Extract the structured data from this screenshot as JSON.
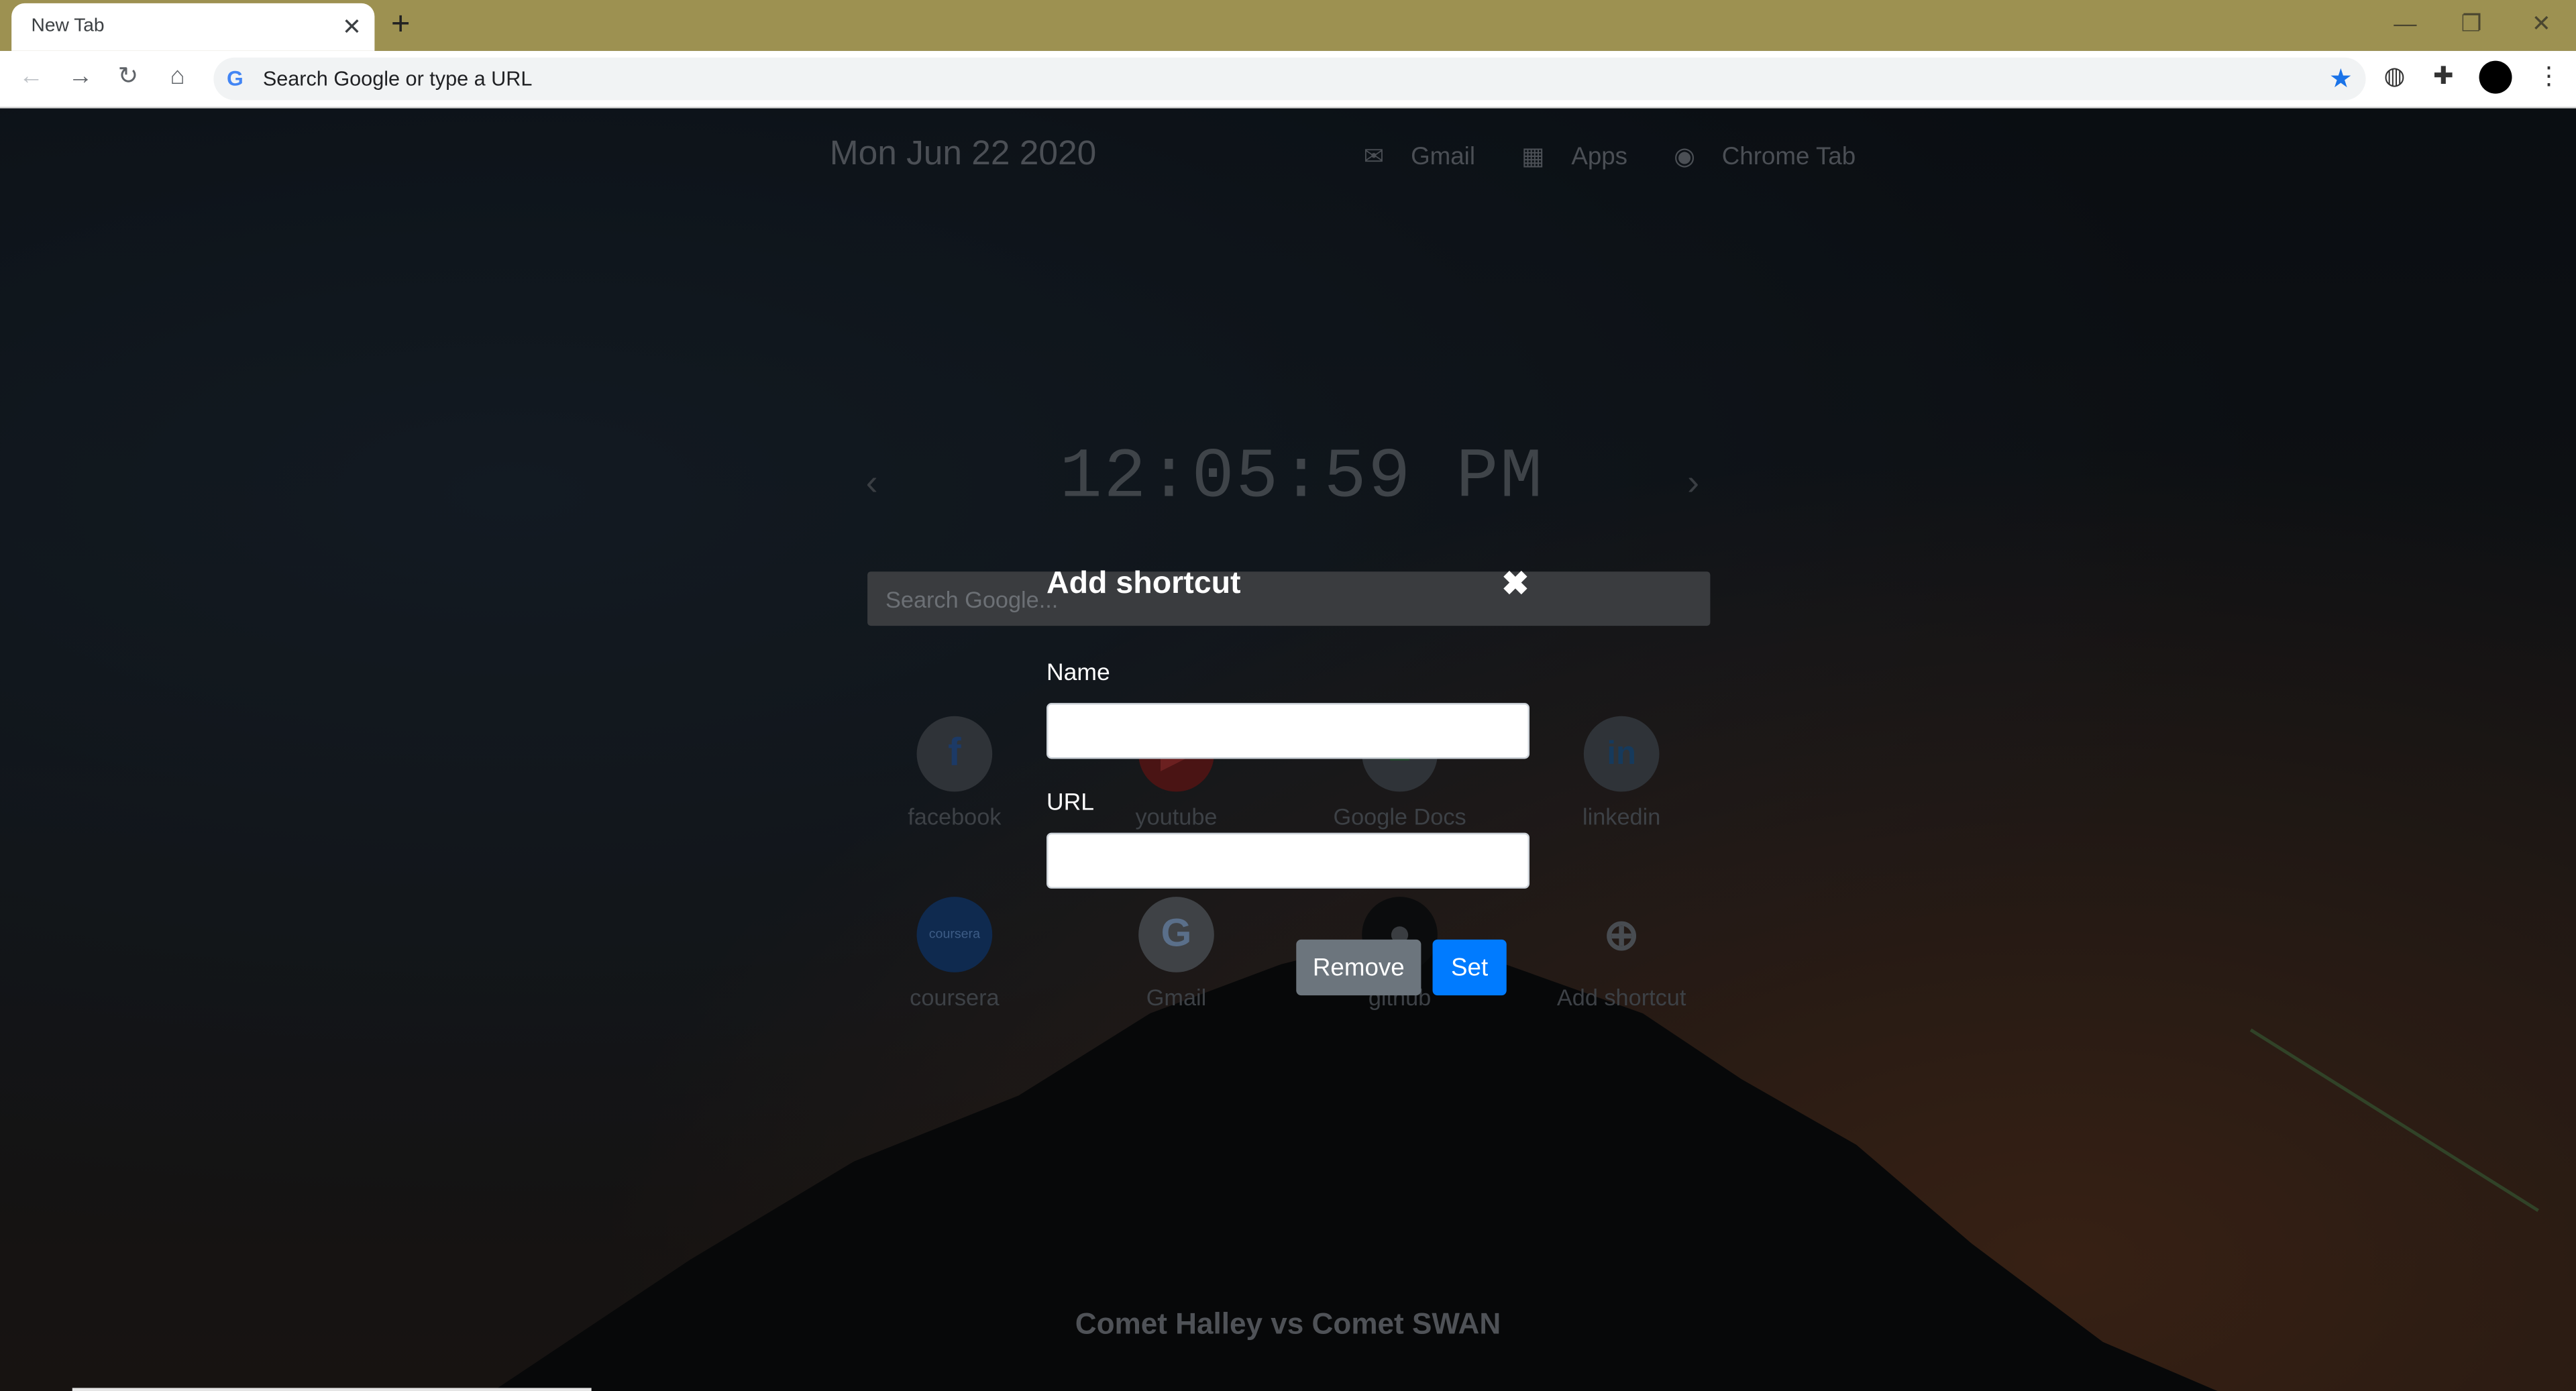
{
  "browser": {
    "tab_title": "New Tab",
    "tab_close": "✕",
    "new_tab": "+",
    "omnibox_placeholder": "Search Google or type a URL",
    "window_controls": [
      "—",
      "❐",
      "✕"
    ],
    "nav": {
      "back": "←",
      "forward": "→",
      "reload": "↻",
      "home": "⌂"
    }
  },
  "header": {
    "date": "Mon Jun 22 2020",
    "links": [
      {
        "icon": "mail-icon",
        "label": "Gmail"
      },
      {
        "icon": "grid-icon",
        "label": "Apps"
      },
      {
        "icon": "chrome-icon",
        "label": "Chrome Tab"
      }
    ]
  },
  "clock": {
    "time": "12:05:59 PM",
    "prev": "‹",
    "next": "›"
  },
  "search": {
    "placeholder": "Search Google..."
  },
  "shortcuts": [
    {
      "label": "facebook",
      "glyph": "f",
      "color": "#1877f2"
    },
    {
      "label": "youtube",
      "glyph": "▶",
      "color": "#ff0000"
    },
    {
      "label": "Google Docs",
      "glyph": "≡",
      "color": "#0f9d58"
    },
    {
      "label": "linkedin",
      "glyph": "in",
      "color": "#0a66c2"
    },
    {
      "label": "coursera",
      "glyph": "coursera",
      "color": "#0056d2"
    },
    {
      "label": "Gmail",
      "glyph": "G",
      "color": "#4285f4"
    },
    {
      "label": "github",
      "glyph": "●",
      "color": "#000000"
    },
    {
      "label": "Add shortcut",
      "glyph": "+",
      "color": "#5f6368"
    }
  ],
  "caption": "Comet Halley vs Comet SWAN",
  "modal": {
    "title": "Add shortcut",
    "close": "✖",
    "name_label": "Name",
    "name_value": "",
    "url_label": "URL",
    "url_value": "",
    "remove_label": "Remove",
    "set_label": "Set"
  }
}
